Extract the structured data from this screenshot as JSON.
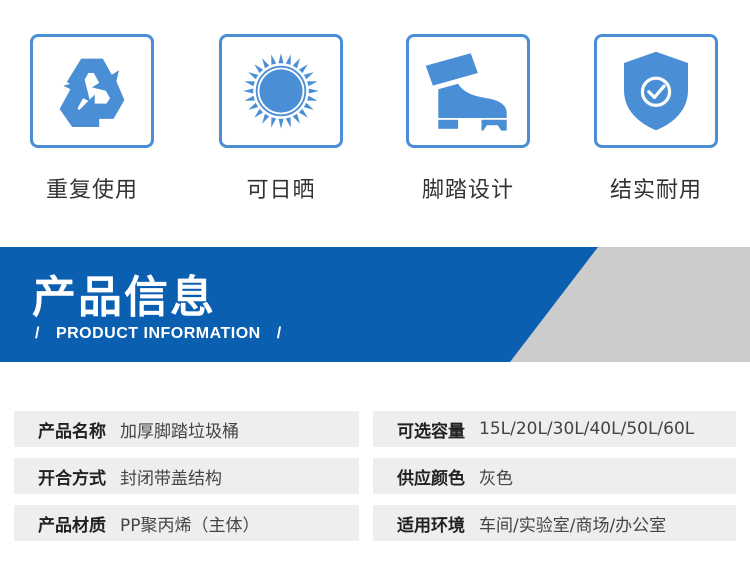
{
  "features": [
    {
      "icon": "recycle-icon",
      "label": "重复使用"
    },
    {
      "icon": "sun-icon",
      "label": "可日晒"
    },
    {
      "icon": "foot-pedal-icon",
      "label": "脚踏设计"
    },
    {
      "icon": "shield-check-icon",
      "label": "结实耐用"
    }
  ],
  "colors": {
    "icon_blue": "#4a8fd6",
    "banner_blue": "#0b5fb0",
    "banner_gray": "#cccccc",
    "row_bg": "#eeeeee"
  },
  "banner": {
    "title": "产品信息",
    "slash_left": "/",
    "subtitle": "PRODUCT INFORMATION",
    "slash_right": "/"
  },
  "info": [
    {
      "key": "产品名称",
      "value": "加厚脚踏垃圾桶"
    },
    {
      "key": "可选容量",
      "value": "15L/20L/30L/40L/50L/60L"
    },
    {
      "key": "开合方式",
      "value": "封闭带盖结构"
    },
    {
      "key": "供应颜色",
      "value": "灰色"
    },
    {
      "key": "产品材质",
      "value": "PP聚丙烯（主体）"
    },
    {
      "key": "适用环境",
      "value": "车间/实验室/商场/办公室"
    }
  ]
}
